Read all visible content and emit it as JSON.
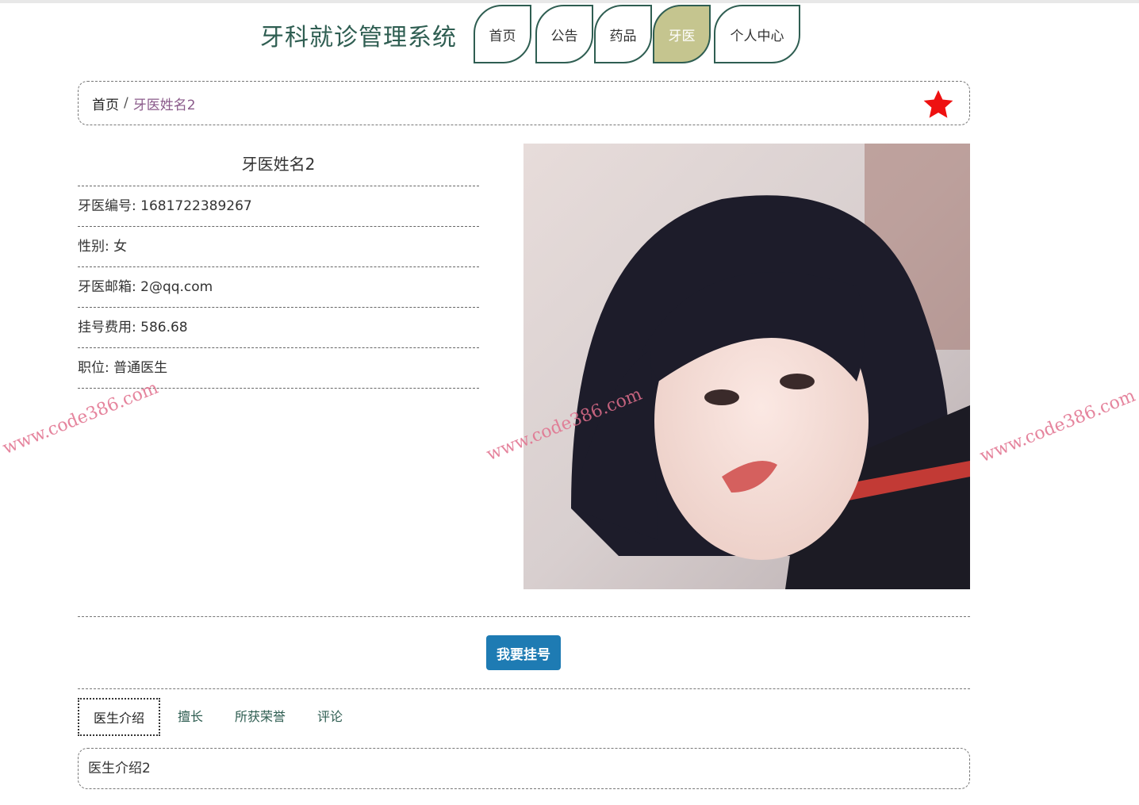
{
  "header": {
    "title": "牙科就诊管理系统",
    "nav": [
      {
        "label": "首页",
        "active": false
      },
      {
        "label": "公告",
        "active": false
      },
      {
        "label": "药品",
        "active": false
      },
      {
        "label": "牙医",
        "active": true
      },
      {
        "label": "个人中心",
        "active": false
      }
    ]
  },
  "breadcrumb": {
    "home": "首页",
    "separator": "/",
    "current": "牙医姓名2"
  },
  "doctor": {
    "name": "牙医姓名2",
    "fields": [
      "牙医编号: 1681722389267",
      "性别: 女",
      "牙医邮箱: 2@qq.com",
      "挂号费用: 586.68",
      "职位: 普通医生"
    ]
  },
  "actions": {
    "book_label": "我要挂号"
  },
  "tabs": [
    {
      "label": "医生介绍",
      "active": true
    },
    {
      "label": "擅长",
      "active": false
    },
    {
      "label": "所获荣誉",
      "active": false
    },
    {
      "label": "评论",
      "active": false
    }
  ],
  "tab_content": "医生介绍2",
  "watermark": "www.code386.com",
  "icons": {
    "favorite": "star-icon",
    "photo": "doctor-photo"
  },
  "colors": {
    "brand": "#2f5e52",
    "active_tab": "#c5c58f",
    "button": "#1e7bb3",
    "star": "#ee1111"
  }
}
